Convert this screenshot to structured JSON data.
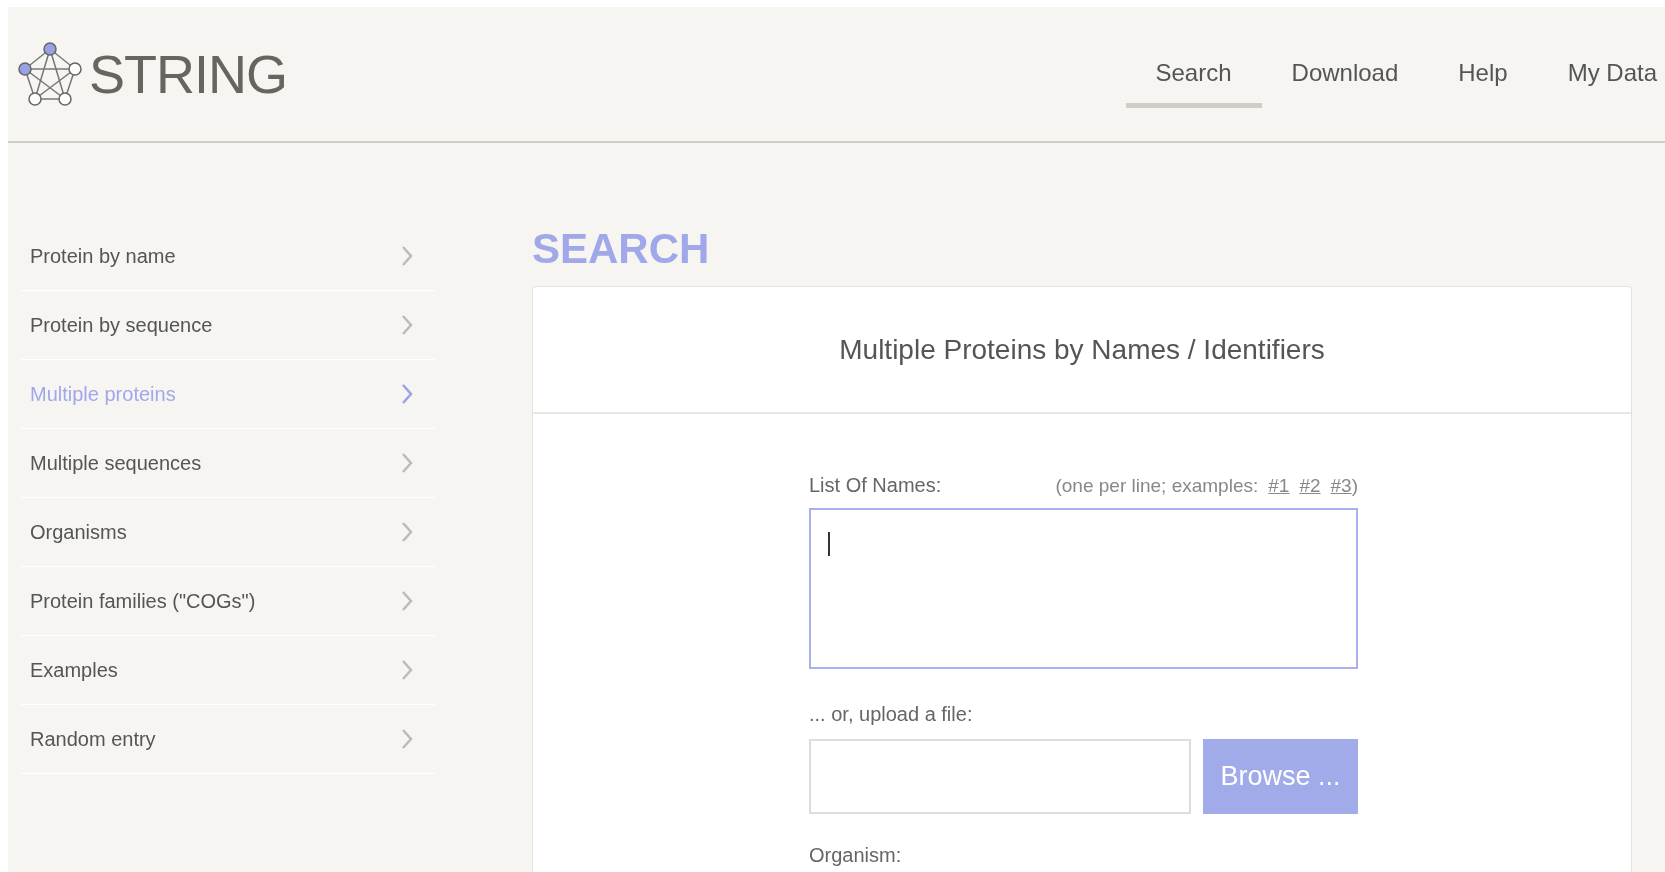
{
  "logo": {
    "text": "STRING"
  },
  "nav": [
    {
      "label": "Search",
      "selected": true
    },
    {
      "label": "Download",
      "selected": false
    },
    {
      "label": "Help",
      "selected": false
    },
    {
      "label": "My Data",
      "selected": false
    }
  ],
  "sidebar": {
    "items": [
      {
        "label": "Protein by name",
        "selected": false
      },
      {
        "label": "Protein by sequence",
        "selected": false
      },
      {
        "label": "Multiple proteins",
        "selected": true
      },
      {
        "label": "Multiple sequences",
        "selected": false
      },
      {
        "label": "Organisms",
        "selected": false
      },
      {
        "label": "Protein families (\"COGs\")",
        "selected": false
      },
      {
        "label": "Examples",
        "selected": false
      },
      {
        "label": "Random entry",
        "selected": false
      }
    ]
  },
  "heading": "SEARCH",
  "card": {
    "title": "Multiple Proteins by Names / Identifiers",
    "names_label": "List Of Names:",
    "hint_prefix": "(one per line; examples:",
    "examples": [
      "#1",
      "#2",
      "#3"
    ],
    "hint_suffix": ")",
    "names_field": {
      "focused": true
    },
    "upload_label": "... or, upload a file:",
    "browse_button": "Browse ...",
    "organism_label": "Organism:"
  }
}
